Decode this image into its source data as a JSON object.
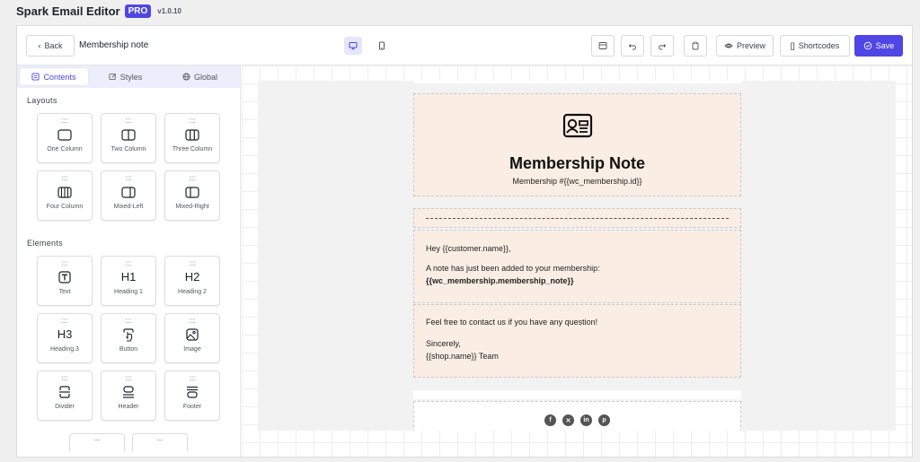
{
  "app": {
    "title": "Spark Email Editor",
    "badge": "PRO",
    "version": "v1.0.10"
  },
  "toolbar": {
    "back_label": "Back",
    "doc_title": "Membership note",
    "preview_label": "Preview",
    "shortcodes_label": "Shortcodes",
    "save_label": "Save",
    "accent": "#4f46e5"
  },
  "left_panel": {
    "tabs": [
      {
        "label": "Contents",
        "icon": "contents-icon",
        "active": true
      },
      {
        "label": "Styles",
        "icon": "brush-icon",
        "active": false
      },
      {
        "label": "Global",
        "icon": "globe-icon",
        "active": false
      }
    ],
    "layouts_title": "Layouts",
    "layouts": [
      {
        "label": "One Column",
        "icon": "one-column-icon"
      },
      {
        "label": "Two Column",
        "icon": "two-column-icon"
      },
      {
        "label": "Three Column",
        "icon": "three-column-icon"
      },
      {
        "label": "Four Column",
        "icon": "four-column-icon"
      },
      {
        "label": "Mixed-Left",
        "icon": "mixed-left-icon"
      },
      {
        "label": "Mixed-Right",
        "icon": "mixed-right-icon"
      }
    ],
    "elements_title": "Elements",
    "elements": [
      {
        "label": "Text",
        "icon": "text-icon",
        "glyph": ""
      },
      {
        "label": "Heading 1",
        "icon": "heading-1-icon",
        "glyph": "H1"
      },
      {
        "label": "Heading 2",
        "icon": "heading-2-icon",
        "glyph": "H2"
      },
      {
        "label": "Heading 3",
        "icon": "heading-3-icon",
        "glyph": "H3"
      },
      {
        "label": "Button",
        "icon": "button-icon",
        "glyph": ""
      },
      {
        "label": "Image",
        "icon": "image-icon",
        "glyph": ""
      },
      {
        "label": "Divider",
        "icon": "divider-icon",
        "glyph": ""
      },
      {
        "label": "Header",
        "icon": "header-icon",
        "glyph": ""
      },
      {
        "label": "Footer",
        "icon": "footer-icon",
        "glyph": ""
      }
    ],
    "grip": ":::",
    "partial_grip": "..."
  },
  "email": {
    "heading": "Membership Note",
    "subheading": "Membership #{{wc_membership.id}}",
    "greeting": "Hey {{customer.name}},",
    "note_intro": "A note has just been added to your membership:",
    "note_var": "{{wc_membership.membership_note}}",
    "contact": "Feel free to contact us if you have any question!",
    "signoff": "Sincerely,",
    "team": "{{shop.name}} Team",
    "block_bg": "#faeee4",
    "social_icons": [
      "facebook-icon",
      "x-icon",
      "linkedin-icon",
      "pinterest-icon"
    ]
  }
}
